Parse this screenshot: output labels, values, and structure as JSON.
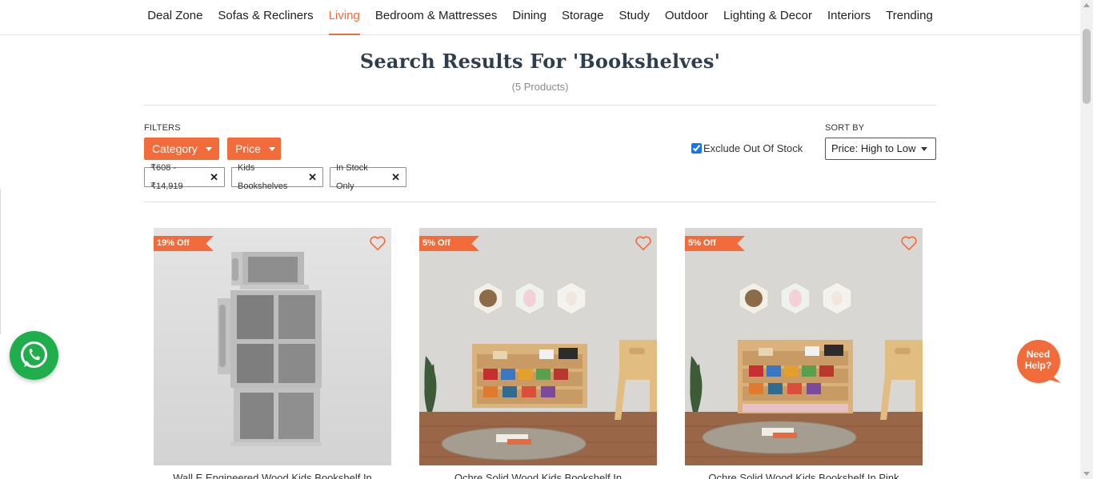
{
  "nav": {
    "items": [
      "Deal Zone",
      "Sofas & Recliners",
      "Living",
      "Bedroom & Mattresses",
      "Dining",
      "Storage",
      "Study",
      "Outdoor",
      "Lighting & Decor",
      "Interiors",
      "Trending"
    ],
    "active": "Living"
  },
  "results": {
    "title": "Search Results For 'Bookshelves'",
    "count": "(5 Products)"
  },
  "filters": {
    "label": "FILTERS",
    "category_label": "Category",
    "price_label": "Price",
    "chips": [
      "₹608 - ₹14,919",
      "Kids Bookshelves",
      "In Stock Only"
    ],
    "exclude_out_of_stock": "Exclude Out Of Stock",
    "exclude_checked": true
  },
  "sort": {
    "label": "SORT BY",
    "selected": "Price: High to Low"
  },
  "products": [
    {
      "discount": "19% Off",
      "title": "Wall E Engineered Wood Kids Bookshelf In"
    },
    {
      "discount": "5% Off",
      "title": "Ochre Solid Wood Kids Bookshelf In"
    },
    {
      "discount": "5% Off",
      "title": "Ochre Solid Wood Kids Bookshelf In Pink"
    }
  ],
  "help": {
    "line1": "Need",
    "line2": "Help?"
  },
  "colors": {
    "accent": "#f26b3a",
    "whatsapp": "#1fae4b",
    "heading": "#2f3e4e"
  },
  "icons": [
    "whatsapp-icon",
    "heart-icon",
    "close-icon",
    "chevron-down-icon"
  ]
}
